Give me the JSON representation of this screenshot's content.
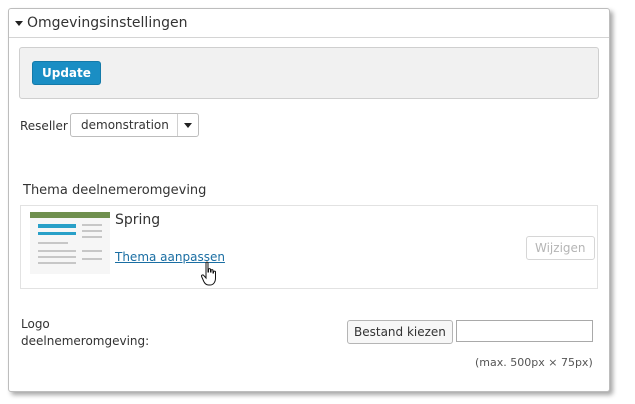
{
  "panel": {
    "title": "Omgevingsinstellingen"
  },
  "toolbar": {
    "update_label": "Update"
  },
  "reseller": {
    "label": "Reseller",
    "selected": "demonstration"
  },
  "theme": {
    "heading": "Thema deelnemeromgeving",
    "name": "Spring",
    "customize_link": "Thema aanpassen",
    "change_label": "Wijzigen"
  },
  "logo": {
    "label": "Logo deelnemeromgeving:",
    "choose_file_label": "Bestand kiezen",
    "file_value": "",
    "size_hint": "(max. 500px × 75px)"
  },
  "colors": {
    "accent": "#1a8ec4",
    "link": "#1a6ea3",
    "toolbar_bg": "#f1f1f1"
  }
}
